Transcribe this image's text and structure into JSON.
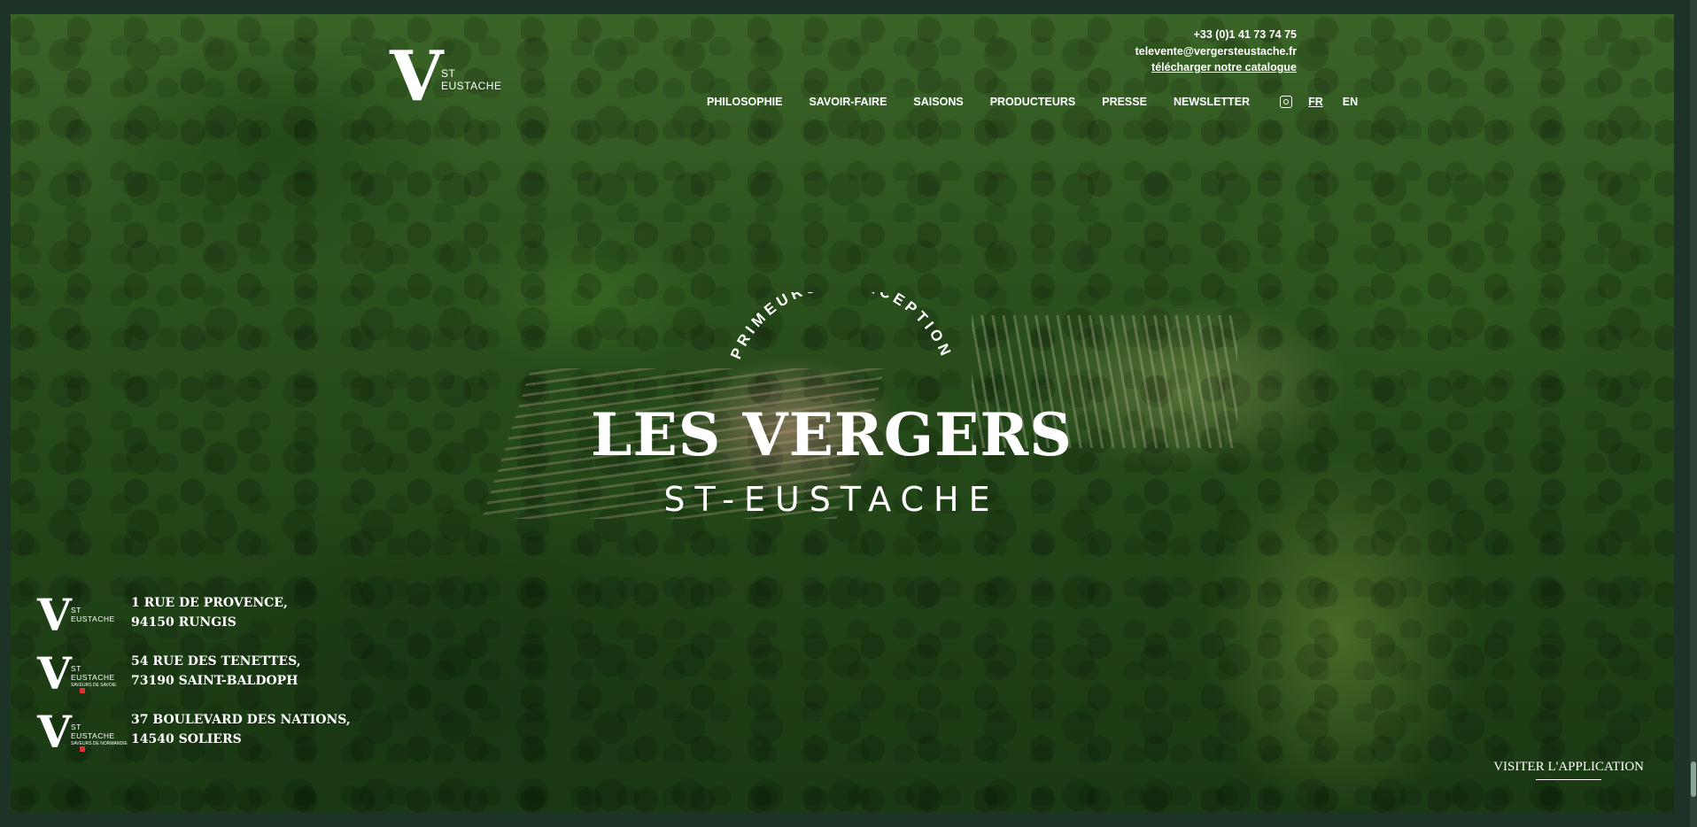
{
  "brand": {
    "logo_letter": "V",
    "logo_line1": "ST",
    "logo_line2": "EUSTACHE"
  },
  "contact": {
    "phone": "+33 (0)1 41 73 74 75",
    "email": "televente@vergersteustache.fr",
    "catalogue_link": "télécharger notre catalogue"
  },
  "nav": {
    "items": [
      "PHILOSOPHIE",
      "SAVOIR-FAIRE",
      "SAISONS",
      "PRODUCTEURS",
      "PRESSE",
      "NEWSLETTER"
    ],
    "lang_fr": "FR",
    "lang_en": "EN",
    "icon": "instagram-icon"
  },
  "hero": {
    "arc_text": "PRIMEURS D'EXCEPTION",
    "title": "LES VERGERS",
    "subtitle": "ST-EUSTACHE"
  },
  "sites": [
    {
      "line1": "1 RUE DE PROVENCE,",
      "line2": "94150 RUNGIS",
      "tag": ""
    },
    {
      "line1": "54 RUE DES TENETTES,",
      "line2": "73190 SAINT-BALDOPH",
      "tag": "SAVEURS DE SAVOIE"
    },
    {
      "line1": "37 BOULEVARD DES NATIONS,",
      "line2": "14540 SOLIERS",
      "tag": "SAVEURS DE NORMANDIE"
    }
  ],
  "app_link": "VISITER L'APPLICATION",
  "colors": {
    "frame": "#1d3328",
    "text": "#ffffff"
  }
}
